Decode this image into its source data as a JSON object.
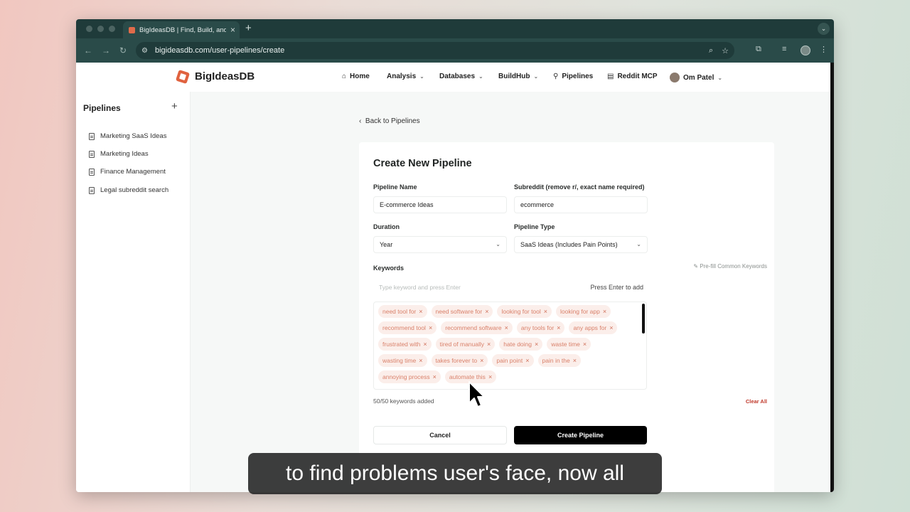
{
  "browser": {
    "tab_title": "BigIdeasDB | Find, Build, and",
    "tab_close": "×",
    "new_tab": "+",
    "url": "bigideasdb.com/user-pipelines/create"
  },
  "site": {
    "logo_text": "BigIdeasDB",
    "nav": {
      "home": "Home",
      "analysis": "Analysis",
      "databases": "Databases",
      "buildhub": "BuildHub",
      "pipelines": "Pipelines",
      "reddit_mcp": "Reddit MCP",
      "user": "Om Patel"
    }
  },
  "sidebar": {
    "title": "Pipelines",
    "add": "+",
    "items": [
      {
        "label": "Marketing SaaS Ideas"
      },
      {
        "label": "Marketing Ideas"
      },
      {
        "label": "Finance Management"
      },
      {
        "label": "Legal subreddit search"
      }
    ]
  },
  "main": {
    "back_link": "Back to Pipelines",
    "form": {
      "title": "Create New Pipeline",
      "pipeline_name_label": "Pipeline Name",
      "pipeline_name_value": "E-commerce Ideas",
      "subreddit_label": "Subreddit (remove r/, exact name required)",
      "subreddit_value": "ecommerce",
      "duration_label": "Duration",
      "duration_value": "Year",
      "type_label": "Pipeline Type",
      "type_value": "SaaS Ideas (Includes Pain Points)",
      "keywords_label": "Keywords",
      "prefill_label": "Pre-fill Common Keywords",
      "keyword_placeholder": "Type keyword and press Enter",
      "keyword_hint": "Press Enter to add",
      "keywords": [
        "need tool for",
        "need software for",
        "looking for tool",
        "looking for app",
        "recommend tool",
        "recommend software",
        "any tools for",
        "any apps for",
        "frustrated with",
        "tired of manually",
        "hate doing",
        "waste time",
        "wasting time",
        "takes forever to",
        "pain point",
        "pain in the",
        "annoying process",
        "automate this"
      ],
      "keyword_count": "50/50 keywords added",
      "clear_all": "Clear All",
      "cancel_label": "Cancel",
      "create_label": "Create Pipeline"
    }
  },
  "caption": "to find problems user's face, now all",
  "colors": {
    "accent": "#e0623f",
    "chip_bg": "#fbeeea",
    "chip_text": "#d9806a",
    "primary_button": "#000000",
    "danger": "#c0392b"
  }
}
